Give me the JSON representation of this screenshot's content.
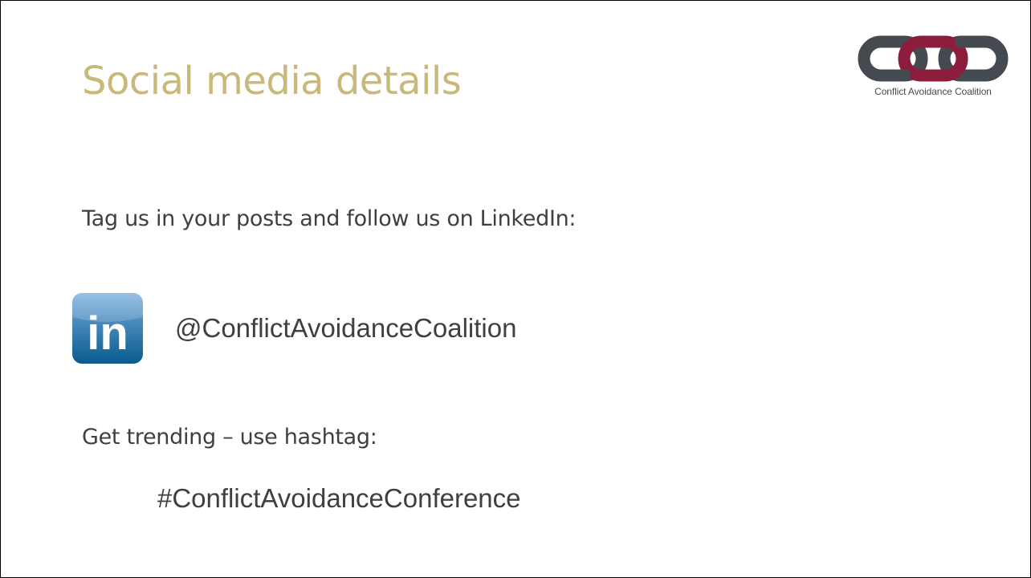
{
  "slide": {
    "title": "Social media details",
    "intro_text": "Tag us in your posts and follow us on LinkedIn:",
    "linkedin_handle": "@ConflictAvoidanceCoalition",
    "trending_text": "Get trending – use hashtag:",
    "hashtag": "#ConflictAvoidanceConference"
  },
  "logo": {
    "text": "Conflict Avoidance Coalition",
    "icon": "chain-links-icon"
  },
  "linkedin_icon": {
    "icon": "linkedin-icon",
    "label": "in"
  },
  "colors": {
    "title": "#c8b97a",
    "body_text": "#3f3f3f",
    "chain_dark": "#454a50",
    "chain_accent": "#8c1d3c",
    "linkedin_blue_top": "#4f8fc2",
    "linkedin_blue_bottom": "#0a5a8f"
  }
}
